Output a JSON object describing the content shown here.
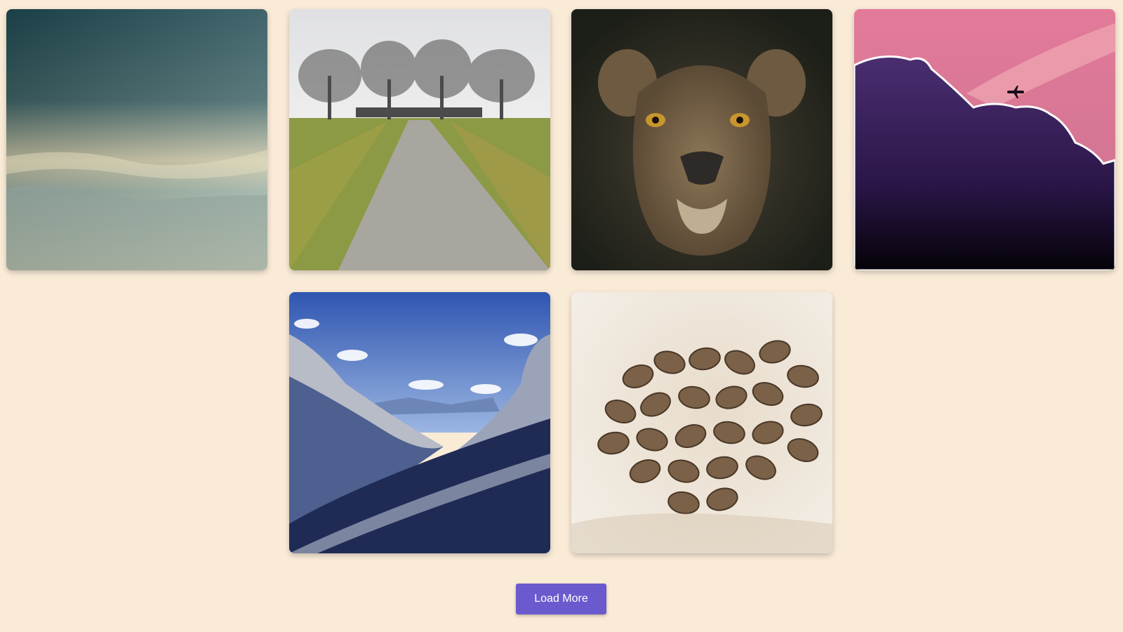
{
  "theme": {
    "background": "#faebd7",
    "button_color": "#6a5acd"
  },
  "gallery": {
    "images": [
      {
        "subject": "stormy-sky"
      },
      {
        "subject": "gravel-path-trees"
      },
      {
        "subject": "lioness-portrait"
      },
      {
        "subject": "sunset-clouds-airplane"
      },
      {
        "subject": "snowy-mountain-valley"
      },
      {
        "subject": "coffee-beans"
      }
    ]
  },
  "load_more": {
    "label": "Load More"
  }
}
